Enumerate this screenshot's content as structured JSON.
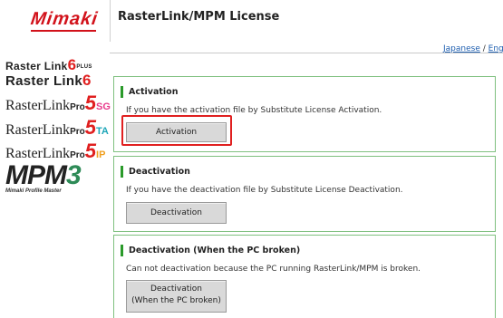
{
  "header": {
    "brand": "Mimaki",
    "title": "RasterLink/MPM License",
    "lang_japanese": "Japanese",
    "lang_separator": " / ",
    "lang_english": "English"
  },
  "products": {
    "rl6plus": {
      "text": "Raster Link",
      "six": "6",
      "plus": "PLUS"
    },
    "rl6": {
      "text": "Raster Link",
      "six": "6"
    },
    "rl5sg": {
      "text": "RasterLink",
      "pro": "Pro",
      "five": "5",
      "suffix": "SG"
    },
    "rl5ta": {
      "text": "RasterLink",
      "pro": "Pro",
      "five": "5",
      "suffix": "TA"
    },
    "rl5ip": {
      "text": "RasterLink",
      "pro": "Pro",
      "five": "5",
      "suffix": "IP"
    },
    "mpm": {
      "text": "MPM",
      "three": "3",
      "sub": "Mimaki Profile Master"
    }
  },
  "panels": {
    "activation": {
      "title": "Activation",
      "description": "If you have the activation file by Substitute License Activation.",
      "button": "Activation"
    },
    "deactivation": {
      "title": "Deactivation",
      "description": "If you have the deactivation file by Substitute License Deactivation.",
      "button": "Deactivation"
    },
    "deactivation_broken": {
      "title": "Deactivation (When the PC broken)",
      "description": "Can not deactivation because the PC running RasterLink/MPM is broken.",
      "button_line1": "Deactivation",
      "button_line2": "(When the PC broken)"
    }
  },
  "colors": {
    "brand_red": "#d2121b",
    "panel_border": "#7fc07f",
    "title_accent": "#2a9a2a",
    "highlight": "#e02020"
  }
}
